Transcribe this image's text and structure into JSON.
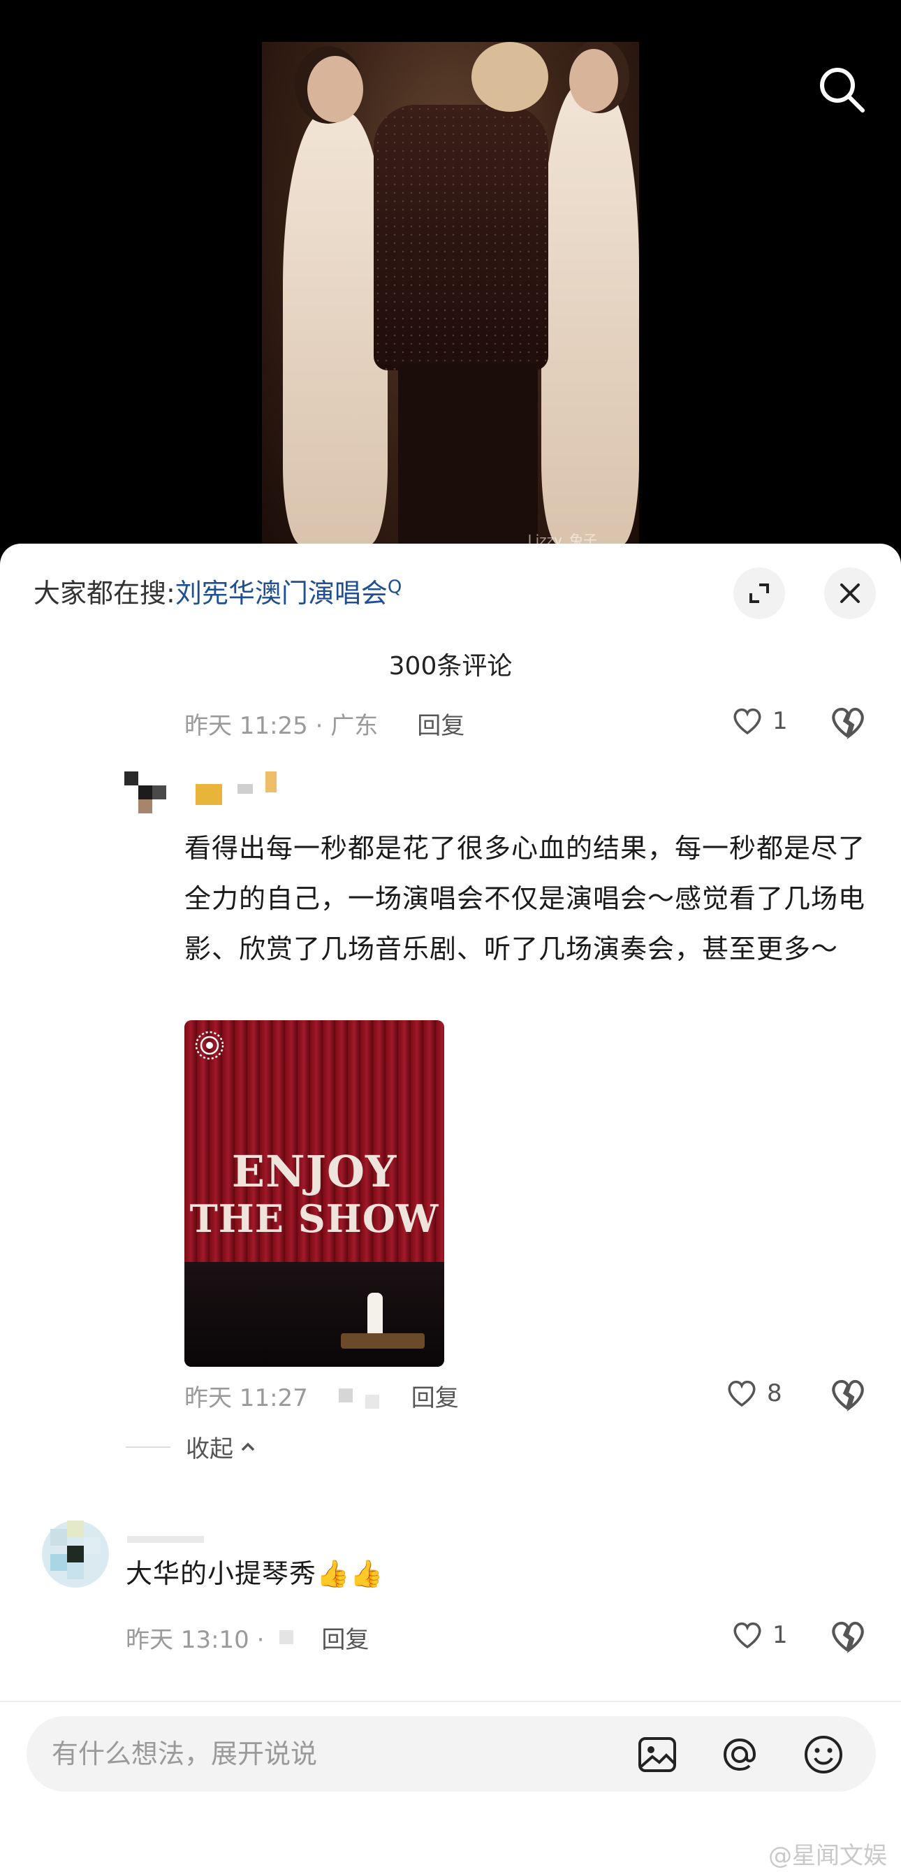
{
  "video": {
    "watermark": "Lizzy_兔子"
  },
  "header": {
    "hot_search_label": "大家都在搜:",
    "hot_search_query": "刘宪华澳门演唱会",
    "hot_search_icon": "search-small-icon"
  },
  "comments_header": {
    "count_text": "300条评论"
  },
  "reply_prev": {
    "time": "昨天 11:25 · 广东",
    "reply_label": "回复",
    "like_count": "1"
  },
  "reply_main": {
    "text": "看得出每一秒都是花了很多心血的结果，每一秒都是尽了全力的自己，一场演唱会不仅是演唱会～感觉看了几场电影、欣赏了几场音乐剧、听了几场演奏会，甚至更多～",
    "image_text_line1": "ENJOY",
    "image_text_line2": "THE SHOW",
    "time": "昨天 11:27",
    "reply_label": "回复",
    "like_count": "8"
  },
  "collapse": {
    "label": "收起",
    "icon": "chevron-up-icon"
  },
  "comment_next": {
    "text": "大华的小提琴秀👍👍",
    "time": "昨天 13:10 ·",
    "reply_label": "回复",
    "like_count": "1"
  },
  "input_bar": {
    "placeholder": "有什么想法，展开说说",
    "icons": [
      "image-icon",
      "at-icon",
      "emoji-icon"
    ]
  },
  "page_watermark": "@星闻文娱",
  "colors": {
    "link": "#1f4f90",
    "meta_gray": "#9a9a9a"
  }
}
